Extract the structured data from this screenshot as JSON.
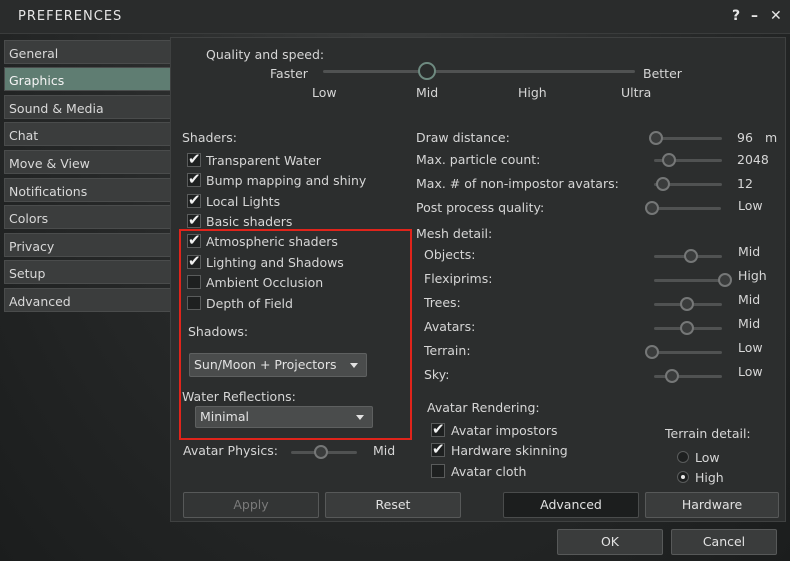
{
  "window": {
    "title": "PREFERENCES",
    "help": "?",
    "minimize": "–",
    "close": "✕"
  },
  "sidebar": {
    "items": [
      {
        "label": "General"
      },
      {
        "label": "Graphics"
      },
      {
        "label": "Sound & Media"
      },
      {
        "label": "Chat"
      },
      {
        "label": "Move & View"
      },
      {
        "label": "Notifications"
      },
      {
        "label": "Colors"
      },
      {
        "label": "Privacy"
      },
      {
        "label": "Setup"
      },
      {
        "label": "Advanced"
      }
    ],
    "active": "Graphics"
  },
  "quality": {
    "label": "Quality and speed:",
    "left": "Faster",
    "right": "Better",
    "ticks": [
      "Low",
      "Mid",
      "High",
      "Ultra"
    ],
    "value": "Mid"
  },
  "shaders": {
    "label": "Shaders:",
    "items": [
      {
        "label": "Transparent Water",
        "checked": true
      },
      {
        "label": "Bump mapping and shiny",
        "checked": true
      },
      {
        "label": "Local Lights",
        "checked": true
      },
      {
        "label": "Basic shaders",
        "checked": true
      },
      {
        "label": "Atmospheric shaders",
        "checked": true
      },
      {
        "label": "Lighting and Shadows",
        "checked": true
      },
      {
        "label": "Ambient Occlusion",
        "checked": false
      },
      {
        "label": "Depth of Field",
        "checked": false
      }
    ],
    "shadows_label": "Shadows:",
    "shadows_value": "Sun/Moon + Projectors",
    "water_label": "Water Reflections:",
    "water_value": "Minimal"
  },
  "physics": {
    "label": "Avatar Physics:",
    "value": "Mid"
  },
  "right": {
    "draw_distance": {
      "label": "Draw distance:",
      "value": "96",
      "unit": "m",
      "level": 0.0
    },
    "particles": {
      "label": "Max. particle count:",
      "value": "2048",
      "level": 0.2
    },
    "non_impostor": {
      "label": "Max. # of non-impostor avatars:",
      "value": "12",
      "level": 0.15
    },
    "post_process": {
      "label": "Post process quality:",
      "value": "Low",
      "level": 0.0
    },
    "mesh_label": "Mesh detail:",
    "mesh": [
      {
        "label": "Objects:",
        "value": "Mid",
        "level": 0.55
      },
      {
        "label": "Flexiprims:",
        "value": "High",
        "level": 1.0
      },
      {
        "label": "Trees:",
        "value": "Mid",
        "level": 0.45
      },
      {
        "label": "Avatars:",
        "value": "Mid",
        "level": 0.45
      },
      {
        "label": "Terrain:",
        "value": "Low",
        "level": 0.0
      },
      {
        "label": "Sky:",
        "value": "Low",
        "level": 0.25
      }
    ]
  },
  "avatar_rendering": {
    "label": "Avatar Rendering:",
    "items": [
      {
        "label": "Avatar impostors",
        "checked": true
      },
      {
        "label": "Hardware skinning",
        "checked": true
      },
      {
        "label": "Avatar cloth",
        "checked": false
      }
    ]
  },
  "terrain_detail": {
    "label": "Terrain detail:",
    "options": [
      "Low",
      "High"
    ],
    "selected": "High"
  },
  "buttons": {
    "apply": "Apply",
    "reset": "Reset",
    "advanced": "Advanced",
    "hardware": "Hardware",
    "ok": "OK",
    "cancel": "Cancel"
  },
  "colors": {
    "accent": "#5f7d72",
    "highlight": "#e0241b"
  }
}
